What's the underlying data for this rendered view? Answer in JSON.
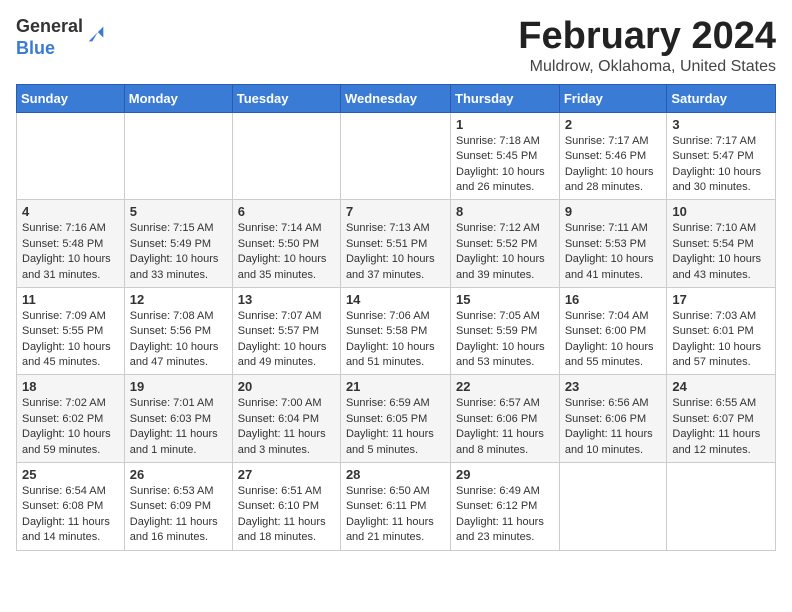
{
  "header": {
    "logo_general": "General",
    "logo_blue": "Blue",
    "month_title": "February 2024",
    "location": "Muldrow, Oklahoma, United States"
  },
  "calendar": {
    "days_of_week": [
      "Sunday",
      "Monday",
      "Tuesday",
      "Wednesday",
      "Thursday",
      "Friday",
      "Saturday"
    ],
    "weeks": [
      [
        {
          "day": "",
          "info": ""
        },
        {
          "day": "",
          "info": ""
        },
        {
          "day": "",
          "info": ""
        },
        {
          "day": "",
          "info": ""
        },
        {
          "day": "1",
          "info": "Sunrise: 7:18 AM\nSunset: 5:45 PM\nDaylight: 10 hours and 26 minutes."
        },
        {
          "day": "2",
          "info": "Sunrise: 7:17 AM\nSunset: 5:46 PM\nDaylight: 10 hours and 28 minutes."
        },
        {
          "day": "3",
          "info": "Sunrise: 7:17 AM\nSunset: 5:47 PM\nDaylight: 10 hours and 30 minutes."
        }
      ],
      [
        {
          "day": "4",
          "info": "Sunrise: 7:16 AM\nSunset: 5:48 PM\nDaylight: 10 hours and 31 minutes."
        },
        {
          "day": "5",
          "info": "Sunrise: 7:15 AM\nSunset: 5:49 PM\nDaylight: 10 hours and 33 minutes."
        },
        {
          "day": "6",
          "info": "Sunrise: 7:14 AM\nSunset: 5:50 PM\nDaylight: 10 hours and 35 minutes."
        },
        {
          "day": "7",
          "info": "Sunrise: 7:13 AM\nSunset: 5:51 PM\nDaylight: 10 hours and 37 minutes."
        },
        {
          "day": "8",
          "info": "Sunrise: 7:12 AM\nSunset: 5:52 PM\nDaylight: 10 hours and 39 minutes."
        },
        {
          "day": "9",
          "info": "Sunrise: 7:11 AM\nSunset: 5:53 PM\nDaylight: 10 hours and 41 minutes."
        },
        {
          "day": "10",
          "info": "Sunrise: 7:10 AM\nSunset: 5:54 PM\nDaylight: 10 hours and 43 minutes."
        }
      ],
      [
        {
          "day": "11",
          "info": "Sunrise: 7:09 AM\nSunset: 5:55 PM\nDaylight: 10 hours and 45 minutes."
        },
        {
          "day": "12",
          "info": "Sunrise: 7:08 AM\nSunset: 5:56 PM\nDaylight: 10 hours and 47 minutes."
        },
        {
          "day": "13",
          "info": "Sunrise: 7:07 AM\nSunset: 5:57 PM\nDaylight: 10 hours and 49 minutes."
        },
        {
          "day": "14",
          "info": "Sunrise: 7:06 AM\nSunset: 5:58 PM\nDaylight: 10 hours and 51 minutes."
        },
        {
          "day": "15",
          "info": "Sunrise: 7:05 AM\nSunset: 5:59 PM\nDaylight: 10 hours and 53 minutes."
        },
        {
          "day": "16",
          "info": "Sunrise: 7:04 AM\nSunset: 6:00 PM\nDaylight: 10 hours and 55 minutes."
        },
        {
          "day": "17",
          "info": "Sunrise: 7:03 AM\nSunset: 6:01 PM\nDaylight: 10 hours and 57 minutes."
        }
      ],
      [
        {
          "day": "18",
          "info": "Sunrise: 7:02 AM\nSunset: 6:02 PM\nDaylight: 10 hours and 59 minutes."
        },
        {
          "day": "19",
          "info": "Sunrise: 7:01 AM\nSunset: 6:03 PM\nDaylight: 11 hours and 1 minute."
        },
        {
          "day": "20",
          "info": "Sunrise: 7:00 AM\nSunset: 6:04 PM\nDaylight: 11 hours and 3 minutes."
        },
        {
          "day": "21",
          "info": "Sunrise: 6:59 AM\nSunset: 6:05 PM\nDaylight: 11 hours and 5 minutes."
        },
        {
          "day": "22",
          "info": "Sunrise: 6:57 AM\nSunset: 6:06 PM\nDaylight: 11 hours and 8 minutes."
        },
        {
          "day": "23",
          "info": "Sunrise: 6:56 AM\nSunset: 6:06 PM\nDaylight: 11 hours and 10 minutes."
        },
        {
          "day": "24",
          "info": "Sunrise: 6:55 AM\nSunset: 6:07 PM\nDaylight: 11 hours and 12 minutes."
        }
      ],
      [
        {
          "day": "25",
          "info": "Sunrise: 6:54 AM\nSunset: 6:08 PM\nDaylight: 11 hours and 14 minutes."
        },
        {
          "day": "26",
          "info": "Sunrise: 6:53 AM\nSunset: 6:09 PM\nDaylight: 11 hours and 16 minutes."
        },
        {
          "day": "27",
          "info": "Sunrise: 6:51 AM\nSunset: 6:10 PM\nDaylight: 11 hours and 18 minutes."
        },
        {
          "day": "28",
          "info": "Sunrise: 6:50 AM\nSunset: 6:11 PM\nDaylight: 11 hours and 21 minutes."
        },
        {
          "day": "29",
          "info": "Sunrise: 6:49 AM\nSunset: 6:12 PM\nDaylight: 11 hours and 23 minutes."
        },
        {
          "day": "",
          "info": ""
        },
        {
          "day": "",
          "info": ""
        }
      ]
    ]
  }
}
